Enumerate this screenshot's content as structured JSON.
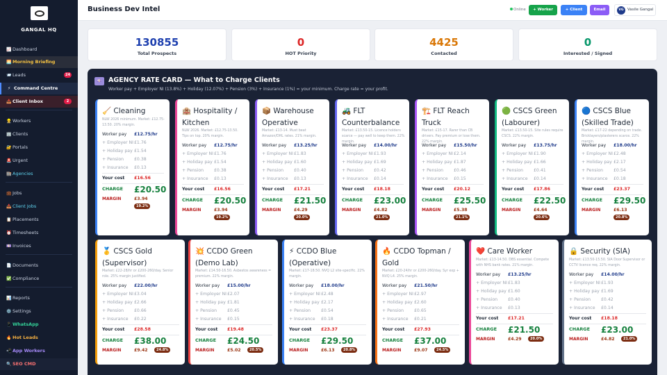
{
  "brand": {
    "name": "GANGAL HQ",
    "logo_text": "GANGAL"
  },
  "sidebar": {
    "items": [
      {
        "icon": "📈",
        "label": "Dashboard",
        "name": "dashboard"
      },
      {
        "icon": "🌅",
        "label": "Morning Briefing",
        "name": "morning-briefing"
      },
      {
        "icon": "📨",
        "label": "Leads",
        "name": "leads",
        "badge": "24"
      },
      {
        "icon": "⚡",
        "label": "Command Centre",
        "name": "command-centre"
      },
      {
        "icon": "📥",
        "label": "Client Inbox",
        "name": "client-inbox",
        "badge": "2"
      },
      {
        "icon": "👷",
        "label": "Workers",
        "name": "workers"
      },
      {
        "icon": "🏢",
        "label": "Clients",
        "name": "clients"
      },
      {
        "icon": "🔐",
        "label": "Portals",
        "name": "portals"
      },
      {
        "icon": "🚨",
        "label": "Urgent",
        "name": "urgent"
      },
      {
        "icon": "🏬",
        "label": "Agencies",
        "name": "agencies"
      },
      {
        "icon": "💼",
        "label": "Jobs",
        "name": "jobs"
      },
      {
        "icon": "📥",
        "label": "Client Jobs",
        "name": "client-jobs"
      },
      {
        "icon": "📋",
        "label": "Placements",
        "name": "placements"
      },
      {
        "icon": "⏰",
        "label": "Timesheets",
        "name": "timesheets"
      },
      {
        "icon": "💷",
        "label": "Invoices",
        "name": "invoices"
      },
      {
        "icon": "📄",
        "label": "Documents",
        "name": "documents"
      },
      {
        "icon": "✅",
        "label": "Compliance",
        "name": "compliance"
      },
      {
        "icon": "📊",
        "label": "Reports",
        "name": "reports"
      },
      {
        "icon": "⚙️",
        "label": "Settings",
        "name": "settings"
      },
      {
        "icon": "📱",
        "label": "WhatsApp",
        "name": "whatsapp"
      },
      {
        "icon": "🔥",
        "label": "Hot Leads",
        "name": "hot-leads"
      },
      {
        "icon": "📲",
        "label": "App Workers",
        "name": "app-workers"
      },
      {
        "icon": "🔍",
        "label": "SEO CMD",
        "name": "seo-cmd"
      }
    ]
  },
  "header": {
    "title": "Business Dev Intel",
    "status": "Online",
    "buttons": {
      "worker": "+ Worker",
      "client": "+ Client",
      "email": "Email"
    },
    "user": {
      "initials": "VG",
      "name": "Vasile Gangal"
    }
  },
  "stats": [
    {
      "value": "130855",
      "label": "Total Prospects",
      "color": "#1e40af"
    },
    {
      "value": "0",
      "label": "HOT Priority",
      "color": "#dc2626"
    },
    {
      "value": "4425",
      "label": "Contacted",
      "color": "#d97706"
    },
    {
      "value": "0",
      "label": "Interested / Signed",
      "color": "#059669"
    }
  ],
  "rate_card": {
    "icon": "💷",
    "title": "AGENCY RATE CARD — What to Charge Clients",
    "subtitle": "Worker pay + Employer NI (13.8%) + Holiday (12.07%) + Pension (3%) + Insurance (1%) = your minimum. Charge rate = your profit.",
    "labels": {
      "worker_pay": "Worker pay",
      "employer_ni": "+ Employer NI",
      "holiday": "+ Holiday pay",
      "pension": "+ Pension",
      "insurance": "+ Insurance",
      "cost": "Your cost",
      "charge": "CHARGE",
      "margin": "MARGIN"
    },
    "cards": [
      {
        "icon": "🧹",
        "title": "Cleaning",
        "desc": "NLW 2026 minimum. Market: £12.75-13.50. 20% margin.",
        "pay": "£12.75/hr",
        "ni": "£1.76",
        "hol": "£1.54",
        "pen": "£0.38",
        "ins": "£0.13",
        "cost": "£16.56",
        "charge": "£20.50",
        "margin": "£3.94",
        "pct": "19.2%",
        "color": "#3b82f6"
      },
      {
        "icon": "🏨",
        "title": "Hospitality / Kitchen",
        "desc": "NLW 2026. Market: £12.75-13.50. Tips on top. 20% margin.",
        "pay": "£12.75/hr",
        "ni": "£1.76",
        "hol": "£1.54",
        "pen": "£0.38",
        "ins": "£0.13",
        "cost": "£16.56",
        "charge": "£20.50",
        "margin": "£3.94",
        "pct": "19.2%",
        "color": "#ec4899"
      },
      {
        "icon": "📦",
        "title": "Warehouse Operative",
        "desc": "Market: £13-14. Must beat Amazon/DHL rates. 21% margin.",
        "pay": "£13.25/hr",
        "ni": "£1.83",
        "hol": "£1.60",
        "pen": "£0.40",
        "ins": "£0.13",
        "cost": "£17.21",
        "charge": "£21.50",
        "margin": "£4.29",
        "pct": "20.0%",
        "color": "#8b5cf6"
      },
      {
        "icon": "🚜",
        "title": "FLT Counterbalance",
        "desc": "Market: £13.50-15. Licence holders scarce — pay well to keep them. 22% margin.",
        "pay": "£14.00/hr",
        "ni": "£1.93",
        "hol": "£1.69",
        "pen": "£0.42",
        "ins": "£0.14",
        "cost": "£18.18",
        "charge": "£23.00",
        "margin": "£4.82",
        "pct": "21.0%",
        "color": "#6366f1"
      },
      {
        "icon": "🏗️",
        "title": "FLT Reach Truck",
        "desc": "Market: £15-17. Rarer than CB drivers. Pay premium or lose them. 22% margin.",
        "pay": "£15.50/hr",
        "ni": "£2.14",
        "hol": "£1.87",
        "pen": "£0.46",
        "ins": "£0.15",
        "cost": "£20.12",
        "charge": "£25.50",
        "margin": "£5.38",
        "pct": "21.1%",
        "color": "#a855f7"
      },
      {
        "icon": "🟢",
        "title": "CSCS Green (Labourer)",
        "desc": "Market: £13.50-15. Site rules require CSCS. 22% margin.",
        "pay": "£13.75/hr",
        "ni": "£1.90",
        "hol": "£1.66",
        "pen": "£0.41",
        "ins": "£0.14",
        "cost": "£17.86",
        "charge": "£22.50",
        "margin": "£4.64",
        "pct": "20.6%",
        "color": "#10b981"
      },
      {
        "icon": "🔵",
        "title": "CSCS Blue (Skilled Trade)",
        "desc": "Market: £17-22 depending on trade. Bricklayers/plasterers scarce. 22% margin.",
        "pay": "£18.00/hr",
        "ni": "£2.48",
        "hol": "£2.17",
        "pen": "£0.54",
        "ins": "£0.18",
        "cost": "£23.37",
        "charge": "£29.50",
        "margin": "£6.13",
        "pct": "20.8%",
        "color": "#3b82f6"
      },
      {
        "icon": "🥇",
        "title": "CSCS Gold (Supervisor)",
        "desc": "Market: £22-28/hr or £200-260/day. Senior role. 25% margin justified.",
        "pay": "£22.00/hr",
        "ni": "£3.04",
        "hol": "£2.66",
        "pen": "£0.66",
        "ins": "£0.22",
        "cost": "£28.58",
        "charge": "£38.00",
        "margin": "£9.42",
        "pct": "24.8%",
        "color": "#f59e0b"
      },
      {
        "icon": "💥",
        "title": "CCDO Green (Demo Lab)",
        "desc": "Market: £14.50-16.50. Asbestos awareness = premium. 22% margin.",
        "pay": "£15.00/hr",
        "ni": "£2.07",
        "hol": "£1.81",
        "pen": "£0.45",
        "ins": "£0.15",
        "cost": "£19.48",
        "charge": "£24.50",
        "margin": "£5.02",
        "pct": "20.5%",
        "color": "#ef4444"
      },
      {
        "icon": "⚡",
        "title": "CCDO Blue (Operative)",
        "desc": "Market: £17-18.50. NVQ L2 site-specific. 22% margin.",
        "pay": "£18.00/hr",
        "ni": "£2.48",
        "hol": "£2.17",
        "pen": "£0.54",
        "ins": "£0.18",
        "cost": "£23.37",
        "charge": "£29.50",
        "margin": "£6.13",
        "pct": "20.8%",
        "color": "#3b82f6"
      },
      {
        "icon": "🔥",
        "title": "CCDO Topman / Gold",
        "desc": "Market: £20-24/hr or £200-260/day. Syr exp + NVQ L4. 25% margin.",
        "pay": "£21.50/hr",
        "ni": "£2.97",
        "hol": "£2.60",
        "pen": "£0.65",
        "ins": "£0.21",
        "cost": "£27.93",
        "charge": "£37.00",
        "margin": "£9.07",
        "pct": "24.5%",
        "color": "#f97316"
      },
      {
        "icon": "❤️",
        "title": "Care Worker",
        "desc": "Market: £13-14.50. DBS essential. Compete with NHS bank rates. 21% margin.",
        "pay": "£13.25/hr",
        "ni": "£1.83",
        "hol": "£1.60",
        "pen": "£0.40",
        "ins": "£0.13",
        "cost": "£17.21",
        "charge": "£21.50",
        "margin": "£4.29",
        "pct": "20.0%",
        "color": "#ec4899"
      },
      {
        "icon": "🔒",
        "title": "Security (SIA)",
        "desc": "Market: £13.50-15.50. SIA Door Supervisor or CCTV licence req. 22% margin.",
        "pay": "£14.00/hr",
        "ni": "£1.93",
        "hol": "£1.69",
        "pen": "£0.42",
        "ins": "£0.14",
        "cost": "£18.18",
        "charge": "£23.00",
        "margin": "£4.82",
        "pct": "21.0%",
        "color": "#64748b"
      }
    ]
  }
}
